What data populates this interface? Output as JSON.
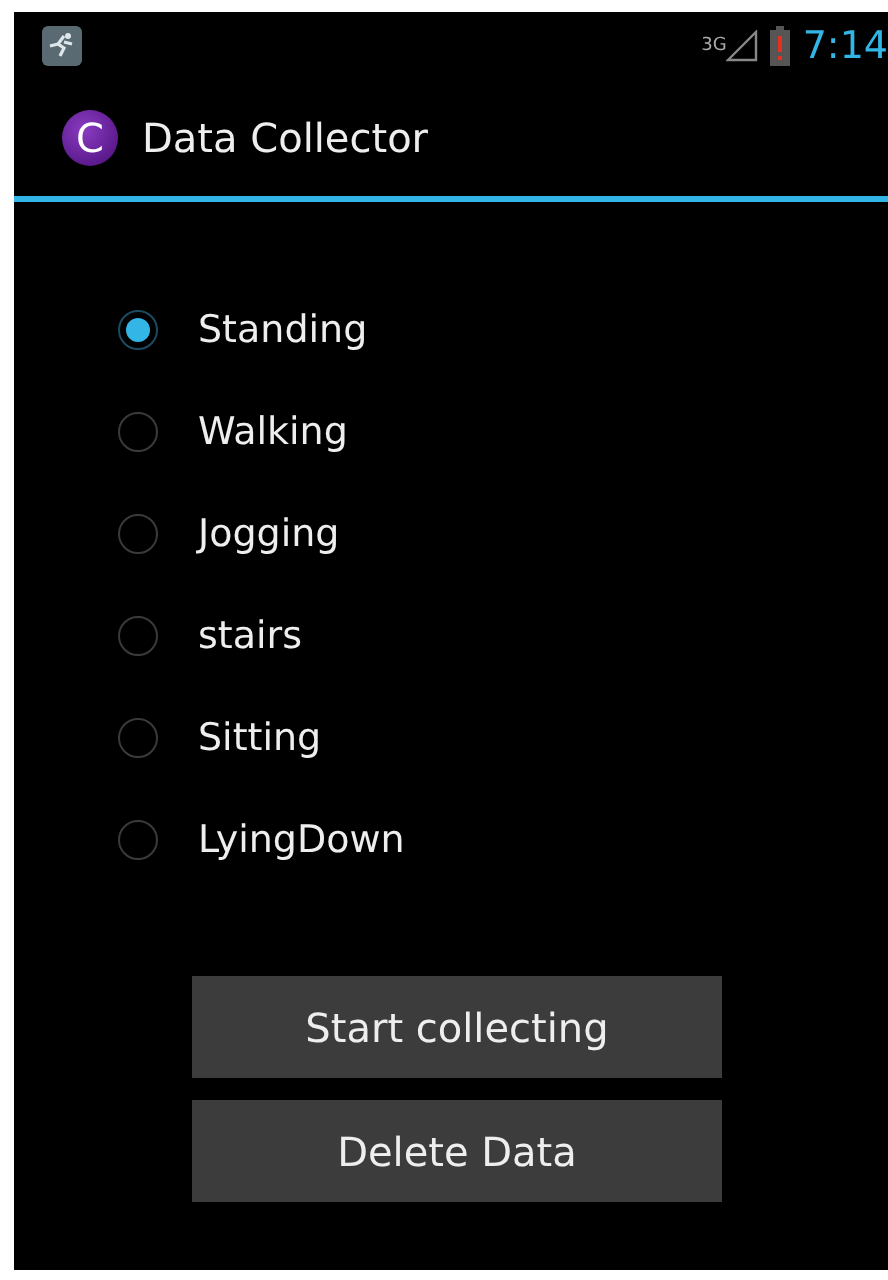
{
  "status_bar": {
    "network": "3G",
    "time": "7:14"
  },
  "action_bar": {
    "icon_letter": "C",
    "title": "Data Collector"
  },
  "activities": [
    {
      "label": "Standing",
      "selected": true
    },
    {
      "label": "Walking",
      "selected": false
    },
    {
      "label": "Jogging",
      "selected": false
    },
    {
      "label": "stairs",
      "selected": false
    },
    {
      "label": "Sitting",
      "selected": false
    },
    {
      "label": "LyingDown",
      "selected": false
    }
  ],
  "buttons": [
    "Start collecting",
    "Delete Data"
  ]
}
